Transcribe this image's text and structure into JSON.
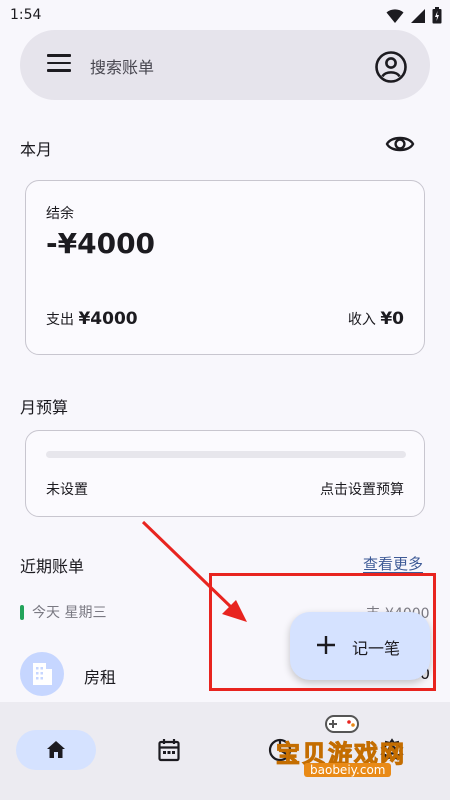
{
  "status_bar": {
    "time": "1:54"
  },
  "search": {
    "placeholder": "搜索账单"
  },
  "month": {
    "label": "本月",
    "balance_label": "结余",
    "balance_value": "-¥4000",
    "expense_label": "支出",
    "expense_value": "¥4000",
    "income_label": "收入",
    "income_value": "¥0"
  },
  "budget": {
    "label": "月预算",
    "status": "未设置",
    "action": "点击设置预算",
    "progress": 0
  },
  "recent": {
    "label": "近期账单",
    "see_more": "查看更多",
    "day_label": "今天 星期三",
    "day_total": "支-¥4000",
    "bill_name": "房租",
    "bill_amount": "-¥4000"
  },
  "fab": {
    "label": "记一笔"
  },
  "nav": {
    "items": [
      "home-icon",
      "calendar-icon",
      "stats-icon",
      "settings-icon"
    ]
  },
  "watermark": {
    "title": "宝贝游戏网",
    "sub": "baobeiy.com"
  },
  "colors": {
    "accent": "#3d5a96",
    "fab_bg": "#d5e2ff",
    "highlight": "#e8241f",
    "today_marker": "#22a35a"
  }
}
